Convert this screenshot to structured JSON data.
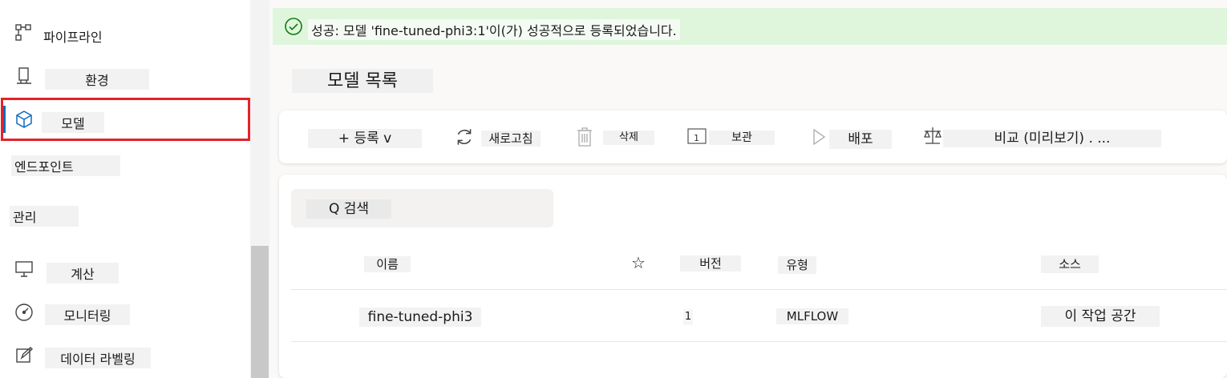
{
  "sidebar": {
    "items": [
      {
        "label": "파이프라인",
        "icon": "pipeline-icon"
      },
      {
        "label": "환경",
        "icon": "environment-icon"
      },
      {
        "label": "모델",
        "icon": "model-cube-icon",
        "selected": true
      },
      {
        "label": "엔드포인트",
        "icon": ""
      },
      {
        "label": "관리",
        "icon": ""
      },
      {
        "label": "계산",
        "icon": "compute-monitor-icon"
      },
      {
        "label": "모니터링",
        "icon": "gauge-icon"
      },
      {
        "label": "데이터 라벨링",
        "icon": "edit-icon"
      }
    ]
  },
  "banner": {
    "text": "성공: 모델 'fine-tuned-phi3:1'이(가) 성공적으로 등록되었습니다.",
    "icon": "check-circle-icon"
  },
  "page": {
    "title": "모델 목록"
  },
  "toolbar": {
    "register": "+ 등록 v",
    "refresh": "새로고침",
    "delete": "삭제",
    "archive": "보관",
    "deploy": "배포",
    "compare": "비교 (미리보기) . ..."
  },
  "search": {
    "label": "Q 검색"
  },
  "table": {
    "columns": [
      "이름",
      "☆",
      "버전",
      "유형",
      "소스"
    ],
    "rows": [
      {
        "name": "fine-tuned-phi3",
        "version": "1",
        "type": "MLFLOW",
        "source": "이 작업 공간"
      }
    ]
  },
  "colors": {
    "accent": "#0f6cbd",
    "selection_highlight": "#e3222b",
    "success_banner": "#dff6dd",
    "success_icon": "#107c10"
  }
}
